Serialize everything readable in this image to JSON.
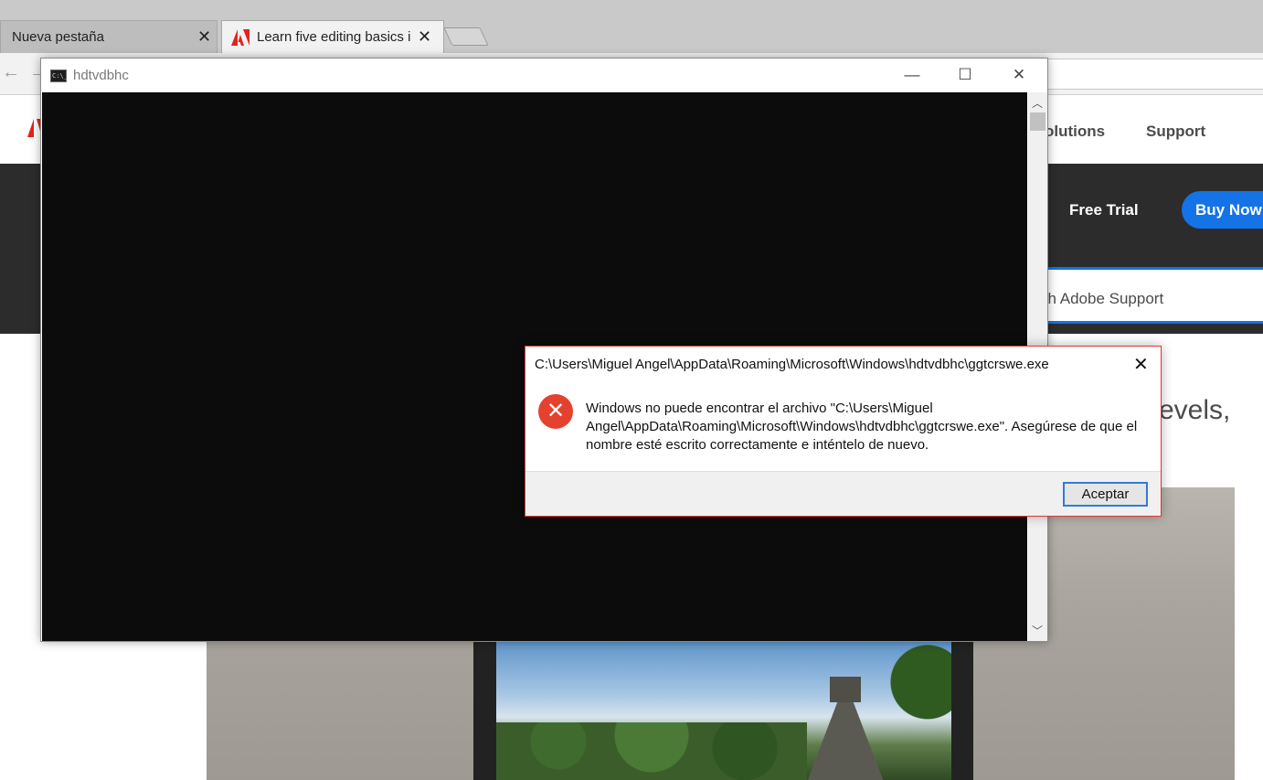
{
  "browser": {
    "tabs": [
      {
        "title": "Nueva pestaña",
        "close": "✕"
      },
      {
        "title": "Learn five editing basics i",
        "close": "✕"
      }
    ]
  },
  "adobe_page": {
    "nav": [
      "olutions",
      "Support"
    ],
    "free_trial": "Free Trial",
    "buy_now": "Buy Now",
    "search_placeholder": "ch Adobe Support",
    "headline_fragment": "evels,"
  },
  "console": {
    "title": "hdtvdbhc",
    "icon_text": "C:\\_"
  },
  "dialog": {
    "title": "C:\\Users\\Miguel Angel\\AppData\\Roaming\\Microsoft\\Windows\\hdtvdbhc\\ggtcrswe.exe",
    "message_line1": "Windows no puede encontrar el archivo \"C:\\Users\\Miguel",
    "message_line2": "Angel\\AppData\\Roaming\\Microsoft\\Windows\\hdtvdbhc\\ggtcrswe.exe\". Asegúrese de que el",
    "message_line3": "nombre esté escrito correctamente e inténtelo de nuevo.",
    "ok_label": "Aceptar"
  },
  "colors": {
    "accent": "#1473e6",
    "error": "#e4412e",
    "console_bg": "#0c0c0c"
  }
}
